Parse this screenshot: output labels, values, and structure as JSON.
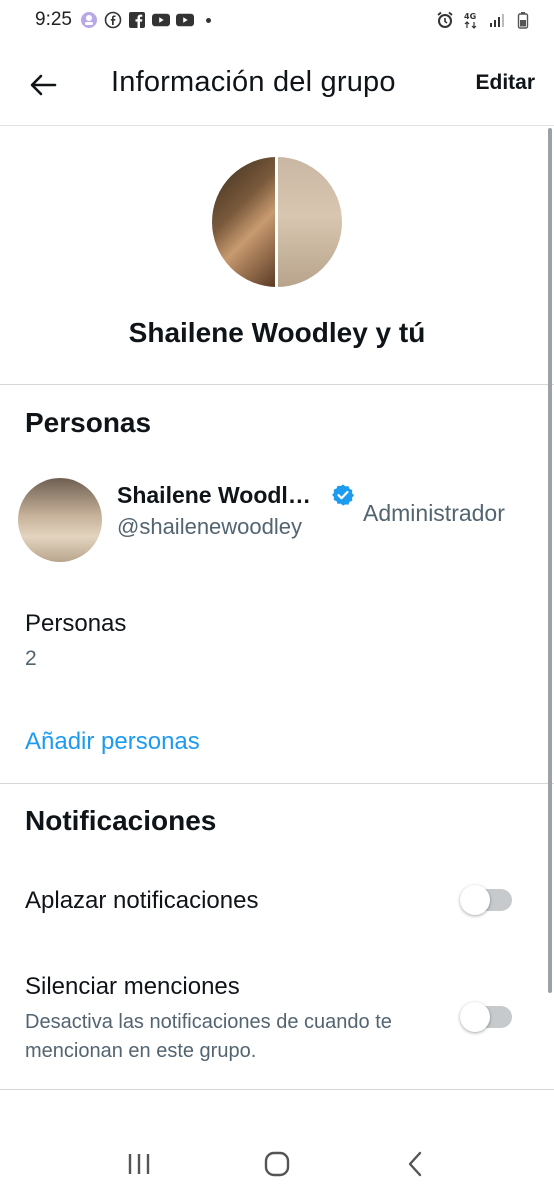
{
  "status_bar": {
    "time": "9:25",
    "network": "4G"
  },
  "header": {
    "title": "Información del grupo",
    "edit_label": "Editar"
  },
  "group": {
    "name": "Shailene Woodley y tú"
  },
  "people_section": {
    "title": "Personas",
    "members": [
      {
        "name": "Shailene Woodl…",
        "handle": "@shailenewoodley",
        "role": "Administrador",
        "verified": true
      }
    ],
    "count_label": "Personas",
    "count_value": "2",
    "add_label": "Añadir personas"
  },
  "notifications_section": {
    "title": "Notificaciones",
    "snooze_label": "Aplazar notificaciones",
    "snooze_on": false,
    "mute_mentions_label": "Silenciar menciones",
    "mute_mentions_desc": "Desactiva las notificaciones de cuando te mencionan en este grupo.",
    "mute_mentions_on": false
  },
  "colors": {
    "accent": "#1d9bf0",
    "text_primary": "#0f1419",
    "text_secondary": "#536471",
    "toggle_off": "#c7cacc"
  },
  "icons": {
    "back": "arrow-left-icon",
    "verified": "verified-badge-icon",
    "nav_recents": "recents-icon",
    "nav_home": "home-icon",
    "nav_back": "chevron-left-icon"
  }
}
